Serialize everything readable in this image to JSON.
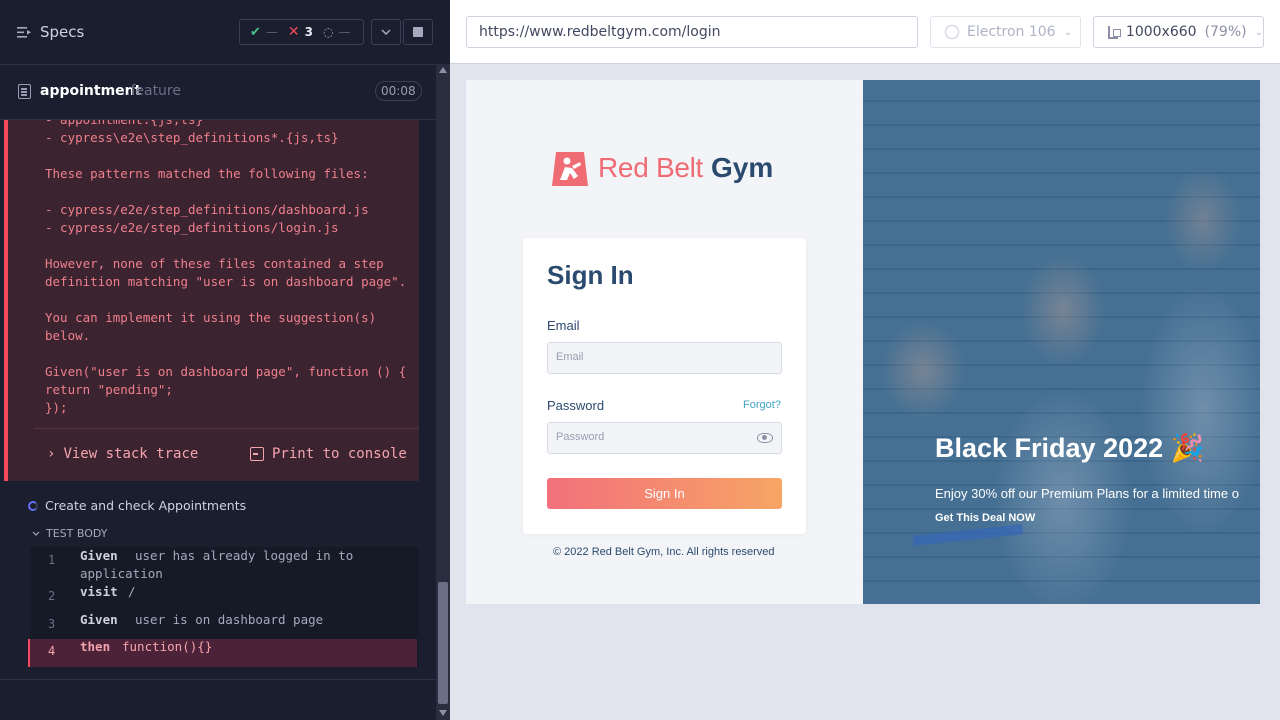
{
  "reporter": {
    "specs_label": "Specs",
    "stats": {
      "passed": "—",
      "failed": "3",
      "pending": "—"
    },
    "file": {
      "name": "appointment",
      "ext": ".feature",
      "duration": "00:08"
    },
    "error_lines": [
      "- appointment.{js,ts}",
      "- cypress\\e2e\\step_definitions*.{js,ts}",
      "",
      "These patterns matched the following files:",
      "",
      "- cypress/e2e/step_definitions/dashboard.js",
      "- cypress/e2e/step_definitions/login.js",
      "",
      "However, none of these files contained a step",
      "definition matching \"user is on dashboard page\".",
      "",
      "You can implement it using the suggestion(s)",
      "below.",
      "",
      "Given(\"user is on dashboard page\", function () {",
      "return \"pending\";",
      "});"
    ],
    "view_stack_trace": "View stack trace",
    "print_to_console": "Print to console",
    "test_title": "Create and check Appointments",
    "test_body_label": "TEST BODY",
    "commands": [
      {
        "num": "1",
        "name": "Given",
        "msg": "user has already logged in to",
        "msg2": "application"
      },
      {
        "num": "2",
        "name": "visit",
        "msg": "/"
      },
      {
        "num": "3",
        "name": "Given",
        "msg": "user is on dashboard page"
      },
      {
        "num": "4",
        "name": "then",
        "msg": "function(){}"
      }
    ]
  },
  "aut": {
    "url": "https://www.redbeltgym.com/login",
    "browser": "Electron 106",
    "viewport": "1000x660",
    "scale": "(79%)"
  },
  "site": {
    "logo_red": "Red Belt",
    "logo_blue": "Gym",
    "card_title": "Sign In",
    "email_label": "Email",
    "email_placeholder": "Email",
    "password_label": "Password",
    "forgot": "Forgot?",
    "password_placeholder": "Password",
    "signin_button": "Sign In",
    "copyright": "© 2022 Red Belt Gym, Inc. All rights reserved",
    "promo_title": "Black Friday 2022 🎉",
    "promo_text": "Enjoy 30% off our Premium Plans for a limited time o",
    "promo_link": "Get This Deal NOW"
  },
  "colors": {
    "fail": "#f14a5e",
    "pass": "#4dbf8f",
    "brand_red": "#ef6c74",
    "brand_blue": "#2b4a6f",
    "accent_blue": "#3fa3c4"
  }
}
